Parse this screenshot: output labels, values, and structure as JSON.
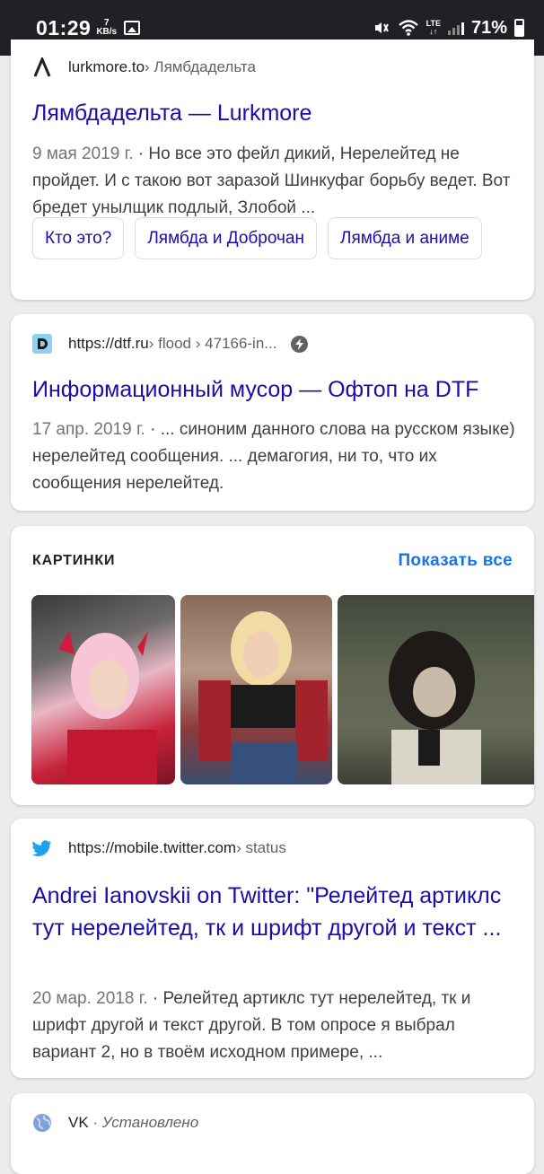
{
  "status_bar": {
    "time": "01:29",
    "speed_value": "7",
    "speed_unit": "KB/s",
    "lte": "LTE",
    "battery": "71%"
  },
  "results": [
    {
      "domain": "lurkmore.to",
      "path": " › Лямбдадельта",
      "title": "Лямбдадельта — Lurkmore",
      "date": "9 мая 2019 г.",
      "snippet": " · Но все это фейл дикий, Нерелейтед не пройдет. И с такою вот заразой Шинкуфаг борьбу ведет. Вот бредет унылщик подлый, Злобой ...",
      "chips": [
        "Кто это?",
        "Лямбда и Доброчан",
        "Лямбда и аниме"
      ]
    },
    {
      "domain": "https://dtf.ru",
      "path": " › flood › 47166-in...",
      "title": "Информационный мусор — Офтоп на DTF",
      "date": "17 апр. 2019 г.",
      "snippet": " · ... синоним данного слова на русском языке) нерелейтед сообщения. ... демагогия, ни то, что их сообщения нерелейтед."
    },
    {
      "domain": "https://mobile.twitter.com",
      "path": " › status",
      "title": "Andrei Ianovskii on Twitter: \"Релейтед артиклс тут нерелейтед, тк и шрифт другой и текст ...",
      "date": "20 мар. 2018 г.",
      "snippet": " · Релейтед артиклс тут нерелейтед, тк и шрифт другой и текст другой. В том опросе я выбрал вариант 2, но в твоём исходном примере, ..."
    },
    {
      "domain": "VK",
      "path": " · ",
      "installed": "Установлено"
    }
  ],
  "images_section": {
    "heading": "КАРТИНКИ",
    "show_all": "Показать все"
  },
  "colors": {
    "link": "#1a0dab",
    "accent": "#1a73e8",
    "status_bar": "#202124",
    "page_bg": "#ececec"
  }
}
